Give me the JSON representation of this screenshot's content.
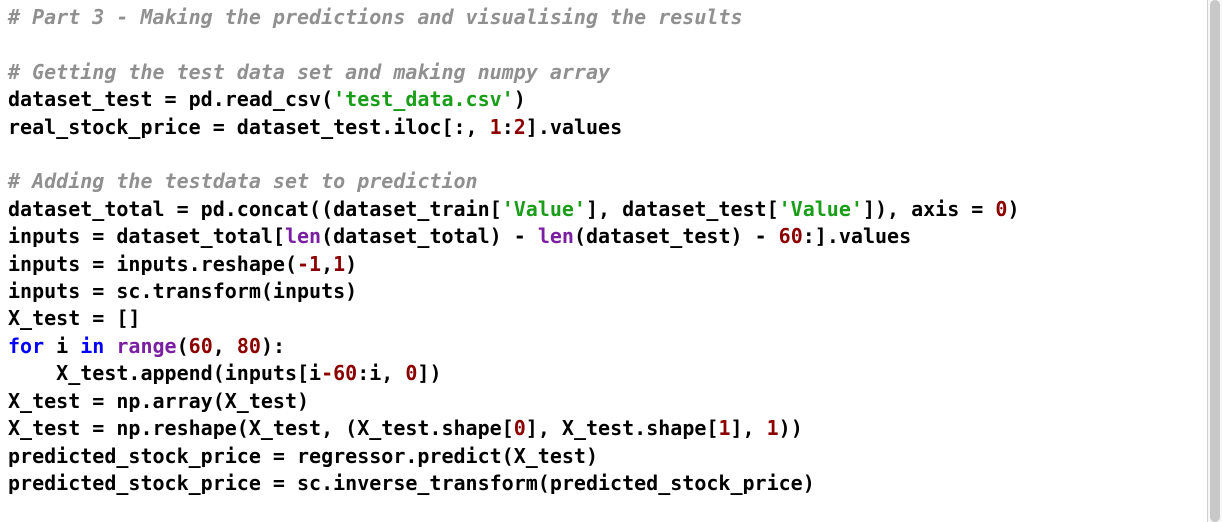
{
  "code": {
    "lines": [
      {
        "type": "comment",
        "text": "# Part 3 - Making the predictions and visualising the results"
      },
      {
        "type": "blank",
        "text": ""
      },
      {
        "type": "comment",
        "text": "# Getting the test data set and making numpy array"
      },
      {
        "type": "code",
        "segments": [
          {
            "cls": "plain",
            "text": "dataset_test = pd.read_csv("
          },
          {
            "cls": "string",
            "text": "'test_data.csv'"
          },
          {
            "cls": "plain",
            "text": ")"
          }
        ]
      },
      {
        "type": "code",
        "segments": [
          {
            "cls": "plain",
            "text": "real_stock_price = dataset_test.iloc[:, "
          },
          {
            "cls": "number",
            "text": "1"
          },
          {
            "cls": "plain",
            "text": ":"
          },
          {
            "cls": "number",
            "text": "2"
          },
          {
            "cls": "plain",
            "text": "].values"
          }
        ]
      },
      {
        "type": "blank",
        "text": ""
      },
      {
        "type": "comment",
        "text": "# Adding the testdata set to prediction"
      },
      {
        "type": "code",
        "segments": [
          {
            "cls": "plain",
            "text": "dataset_total = pd.concat((dataset_train["
          },
          {
            "cls": "string",
            "text": "'Value'"
          },
          {
            "cls": "plain",
            "text": "], dataset_test["
          },
          {
            "cls": "string",
            "text": "'Value'"
          },
          {
            "cls": "plain",
            "text": "]), axis = "
          },
          {
            "cls": "number",
            "text": "0"
          },
          {
            "cls": "plain",
            "text": ")"
          }
        ]
      },
      {
        "type": "code",
        "segments": [
          {
            "cls": "plain",
            "text": "inputs = dataset_total["
          },
          {
            "cls": "builtin",
            "text": "len"
          },
          {
            "cls": "plain",
            "text": "(dataset_total) - "
          },
          {
            "cls": "builtin",
            "text": "len"
          },
          {
            "cls": "plain",
            "text": "(dataset_test) - "
          },
          {
            "cls": "number",
            "text": "60"
          },
          {
            "cls": "plain",
            "text": ":].values"
          }
        ]
      },
      {
        "type": "code",
        "segments": [
          {
            "cls": "plain",
            "text": "inputs = inputs.reshape("
          },
          {
            "cls": "number",
            "text": "-1"
          },
          {
            "cls": "plain",
            "text": ","
          },
          {
            "cls": "number",
            "text": "1"
          },
          {
            "cls": "plain",
            "text": ")"
          }
        ]
      },
      {
        "type": "code",
        "segments": [
          {
            "cls": "plain",
            "text": "inputs = sc.transform(inputs)"
          }
        ]
      },
      {
        "type": "code",
        "segments": [
          {
            "cls": "plain",
            "text": "X_test = []"
          }
        ]
      },
      {
        "type": "code",
        "segments": [
          {
            "cls": "keyword",
            "text": "for"
          },
          {
            "cls": "plain",
            "text": " i "
          },
          {
            "cls": "keyword",
            "text": "in"
          },
          {
            "cls": "plain",
            "text": " "
          },
          {
            "cls": "builtin",
            "text": "range"
          },
          {
            "cls": "plain",
            "text": "("
          },
          {
            "cls": "number",
            "text": "60"
          },
          {
            "cls": "plain",
            "text": ", "
          },
          {
            "cls": "number",
            "text": "80"
          },
          {
            "cls": "plain",
            "text": "):"
          }
        ]
      },
      {
        "type": "code",
        "segments": [
          {
            "cls": "plain",
            "text": "    X_test.append(inputs[i"
          },
          {
            "cls": "number",
            "text": "-60"
          },
          {
            "cls": "plain",
            "text": ":i, "
          },
          {
            "cls": "number",
            "text": "0"
          },
          {
            "cls": "plain",
            "text": "])"
          }
        ]
      },
      {
        "type": "code",
        "segments": [
          {
            "cls": "plain",
            "text": "X_test = np.array(X_test)"
          }
        ]
      },
      {
        "type": "code",
        "segments": [
          {
            "cls": "plain",
            "text": "X_test = np.reshape(X_test, (X_test.shape["
          },
          {
            "cls": "number",
            "text": "0"
          },
          {
            "cls": "plain",
            "text": "], X_test.shape["
          },
          {
            "cls": "number",
            "text": "1"
          },
          {
            "cls": "plain",
            "text": "], "
          },
          {
            "cls": "number",
            "text": "1"
          },
          {
            "cls": "plain",
            "text": "))"
          }
        ]
      },
      {
        "type": "code",
        "segments": [
          {
            "cls": "plain",
            "text": "predicted_stock_price = regressor.predict(X_test)"
          }
        ]
      },
      {
        "type": "code",
        "segments": [
          {
            "cls": "plain",
            "text": "predicted_stock_price = sc.inverse_transform(predicted_stock_price)"
          }
        ]
      }
    ]
  },
  "scrollbar": {
    "thumb_top_pct": 0,
    "thumb_height_pct": 100
  }
}
